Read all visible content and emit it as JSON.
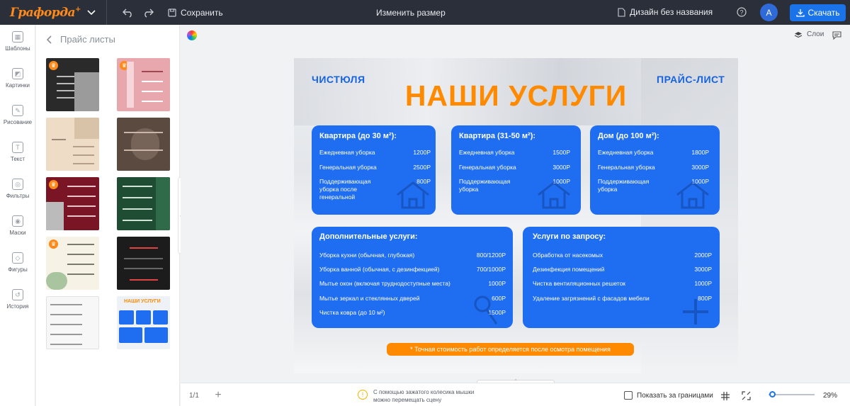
{
  "topbar": {
    "logo": "Графорда",
    "logo_plus": "+",
    "save_label": "Сохранить",
    "resize_label": "Изменить размер",
    "doc_name": "Дизайн без названия",
    "avatar_letter": "А",
    "download_label": "Скачать"
  },
  "rail": {
    "items": [
      {
        "label": "Шаблоны",
        "icon": "templates-icon"
      },
      {
        "label": "Картинки",
        "icon": "images-icon"
      },
      {
        "label": "Рисование",
        "icon": "draw-icon"
      },
      {
        "label": "Текст",
        "icon": "text-icon",
        "glyph": "T"
      },
      {
        "label": "Фильтры",
        "icon": "filters-icon"
      },
      {
        "label": "Маски",
        "icon": "masks-icon"
      },
      {
        "label": "Фигуры",
        "icon": "shapes-icon"
      },
      {
        "label": "История",
        "icon": "history-icon"
      }
    ]
  },
  "panel": {
    "title": "Прайс листы",
    "thumb_nashi": "НАШИ УСЛУГИ"
  },
  "workspace": {
    "layers_label": "Слои"
  },
  "design": {
    "brand": "ЧИСТЮЛЯ",
    "price_label": "ПРАЙС-ЛИСТ",
    "title": "НАШИ УСЛУГИ",
    "cards": [
      {
        "title": "Квартира (до 30 м²):",
        "rows": [
          {
            "label": "Ежедневная уборка",
            "value": "1200Р"
          },
          {
            "label": "Генеральная уборка",
            "value": "2500Р"
          },
          {
            "label": "Поддерживающая уборка после генеральной",
            "value": "800Р"
          }
        ]
      },
      {
        "title": "Квартира (31-50 м²):",
        "rows": [
          {
            "label": "Ежедневная уборка",
            "value": "1500Р"
          },
          {
            "label": "Генеральная уборка",
            "value": "3000Р"
          },
          {
            "label": "Поддерживающая уборка",
            "value": "1000Р"
          }
        ]
      },
      {
        "title": "Дом (до 100 м²):",
        "rows": [
          {
            "label": "Ежедневная уборка",
            "value": "1800Р"
          },
          {
            "label": "Генеральная уборка",
            "value": "3000Р"
          },
          {
            "label": "Поддерживающая уборка",
            "value": "1000Р"
          }
        ]
      }
    ],
    "extra": {
      "title": "Дополнительные услуги:",
      "rows": [
        {
          "label": "Уборка кухни (обычная, глубокая)",
          "value": "800/1200Р"
        },
        {
          "label": "Уборка ванной (обычная, с дезинфекцией)",
          "value": "700/1000Р"
        },
        {
          "label": "Мытье окон (включая труднодоступные места)",
          "value": "1000Р"
        },
        {
          "label": "Мытье зеркал и стеклянных дверей",
          "value": "600Р"
        },
        {
          "label": "Чистка ковра (до 10 м²)",
          "value": "1500Р"
        }
      ]
    },
    "request": {
      "title": "Услуги по запросу:",
      "rows": [
        {
          "label": "Обработка от насекомых",
          "value": "2000Р"
        },
        {
          "label": "Дезинфекция помещений",
          "value": "3000Р"
        },
        {
          "label": "Чистка вентиляционных решеток",
          "value": "1000Р"
        },
        {
          "label": "Удаление загрязнений с фасадов мебели",
          "value": "800Р"
        }
      ]
    },
    "note": "* Точная стоимость работ определяется после осмотра помещения"
  },
  "bottombar": {
    "pages": "1/1",
    "hint": "С помощью зажатого колесика мышки можно перемещать сцену",
    "show_bounds_label": "Показать за границами",
    "zoom": "29%"
  },
  "colors": {
    "accent": "#1a73e8",
    "card_blue": "#1f6df0",
    "orange": "#ff8a00",
    "topbar": "#2b2f3a"
  }
}
